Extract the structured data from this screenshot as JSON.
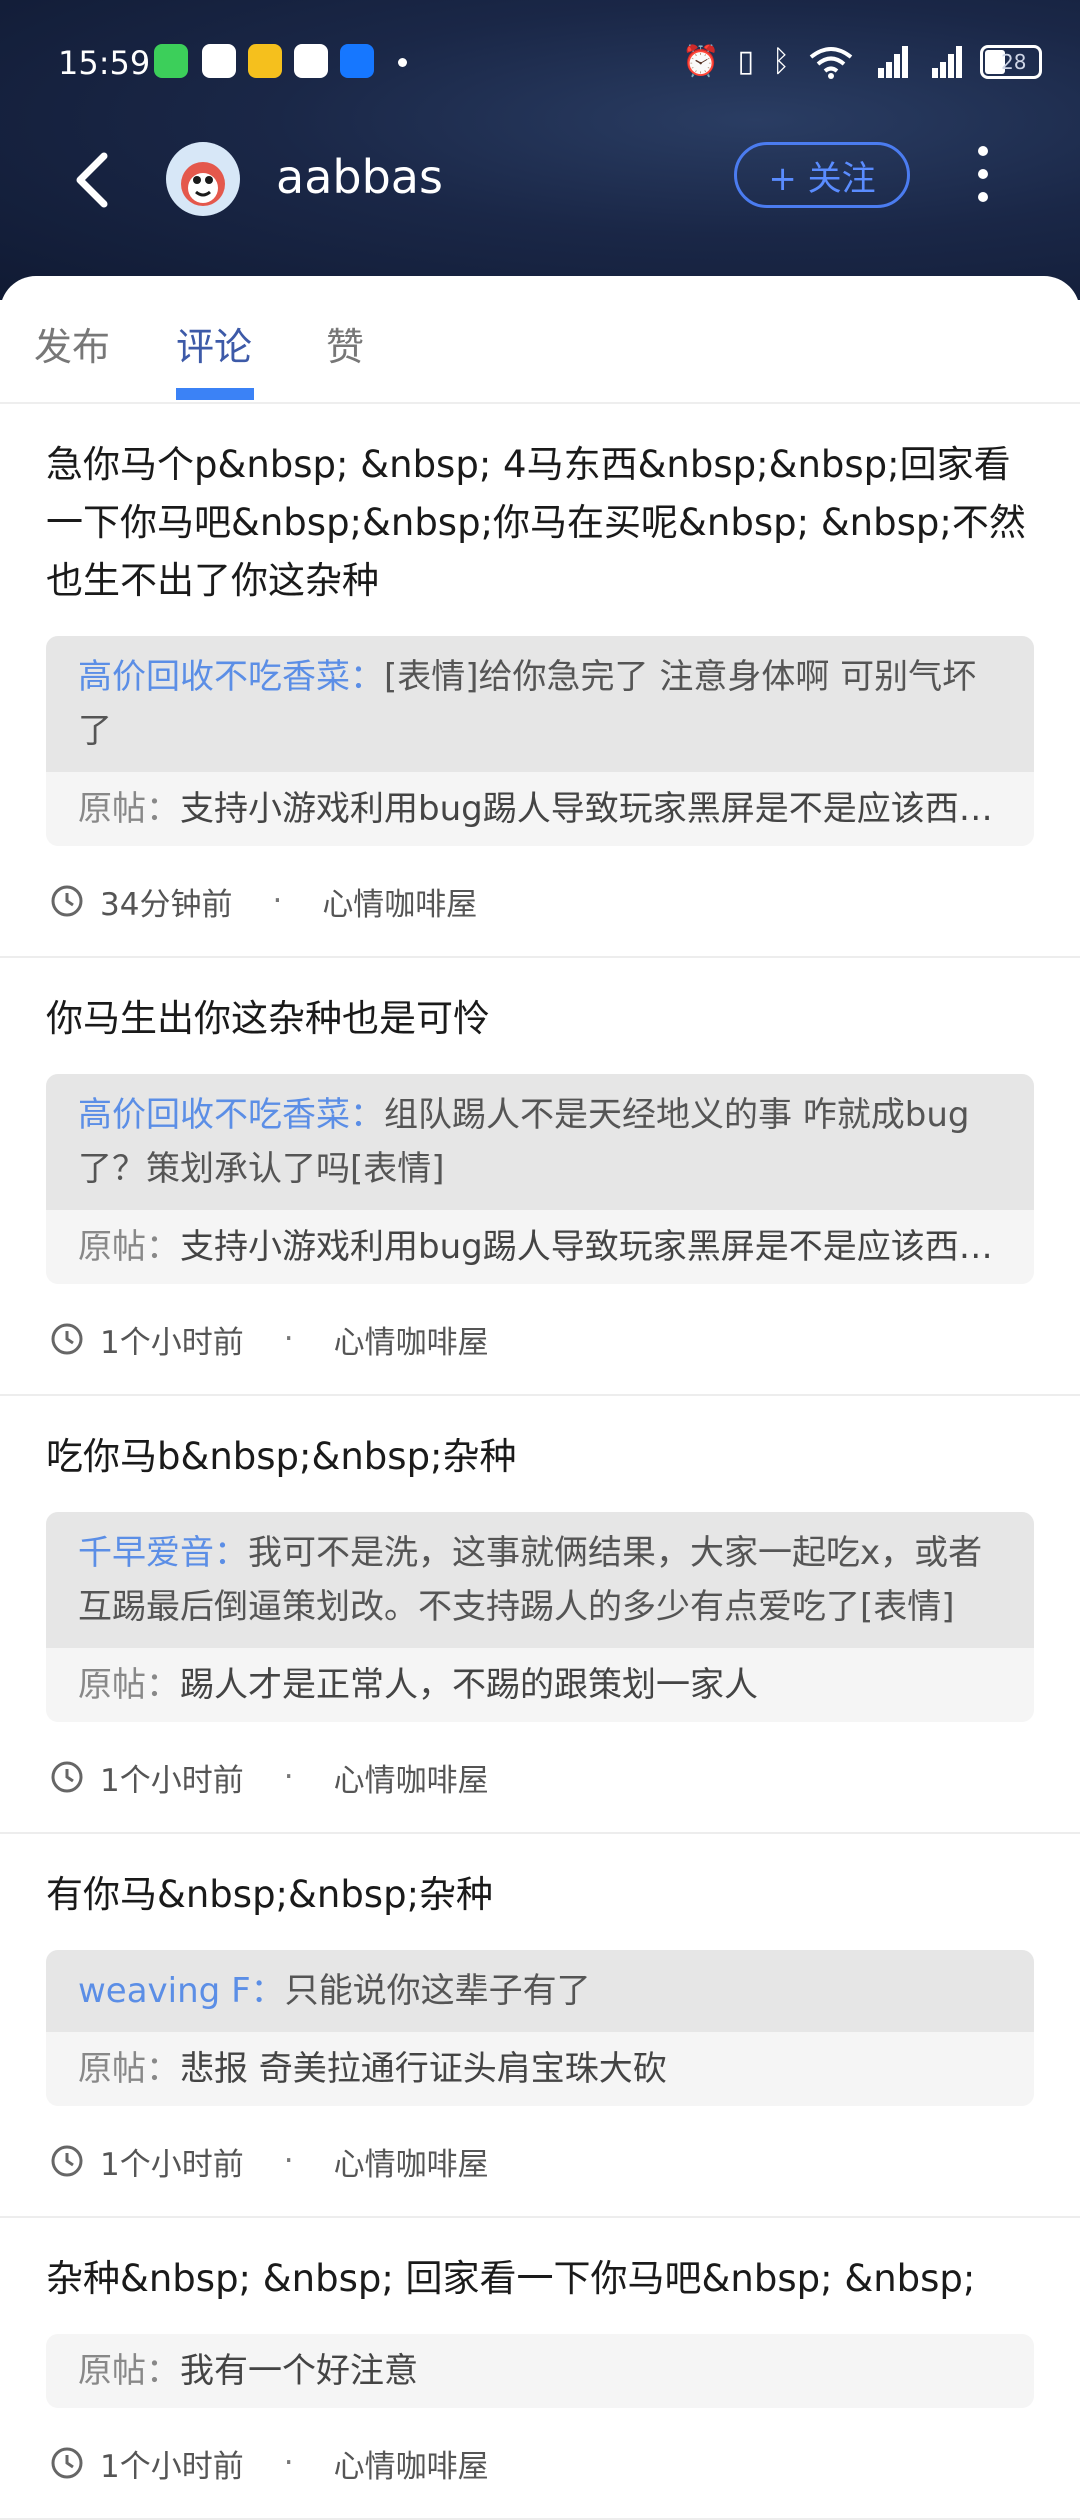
{
  "status_bar": {
    "time": "15:59",
    "battery": "28"
  },
  "header": {
    "username": "aabbas",
    "follow_label": "+ 关注"
  },
  "tabs": [
    {
      "label": "发布",
      "active": false
    },
    {
      "label": "评论",
      "active": true
    },
    {
      "label": "赞",
      "active": false
    }
  ],
  "comments": [
    {
      "text": "急你马个p&nbsp; &nbsp; 4马东西&nbsp;&nbsp;回家看一下你马吧&nbsp;&nbsp;你马在买呢&nbsp; &nbsp;不然也生不出了你这杂种",
      "reply_user": "高价回收不吃香菜：",
      "reply_text": "[表情]给你急完了 注意身体啊 可别气坏了",
      "orig_label": "原帖：",
      "orig_text": "支持小游戏利用bug踢人导致玩家黑屏是不是应该西…",
      "time": "34分钟前",
      "dot": "·",
      "group": "心情咖啡屋"
    },
    {
      "text": "你马生出你这杂种也是可怜",
      "reply_user": "高价回收不吃香菜：",
      "reply_text": "组队踢人不是天经地义的事 咋就成bug了？策划承认了吗[表情]",
      "orig_label": "原帖：",
      "orig_text": "支持小游戏利用bug踢人导致玩家黑屏是不是应该西…",
      "time": "1个小时前",
      "dot": "·",
      "group": "心情咖啡屋"
    },
    {
      "text": "吃你马b&nbsp;&nbsp;杂种",
      "reply_user": "千早爱音：",
      "reply_text": "我可不是洗，这事就俩结果，大家一起吃x，或者互踢最后倒逼策划改。不支持踢人的多少有点爱吃了[表情]",
      "orig_label": "原帖：",
      "orig_text": "踢人才是正常人，不踢的跟策划一家人",
      "time": "1个小时前",
      "dot": "·",
      "group": "心情咖啡屋"
    },
    {
      "text": "有你马&nbsp;&nbsp;杂种",
      "reply_user": "weaving F：",
      "reply_text": "只能说你这辈子有了",
      "orig_label": "原帖：",
      "orig_text": "悲报 奇美拉通行证头肩宝珠大砍",
      "time": "1个小时前",
      "dot": "·",
      "group": "心情咖啡屋"
    },
    {
      "text": "杂种&nbsp; &nbsp; 回家看一下你马吧&nbsp; &nbsp;",
      "orig_label": "原帖：",
      "orig_text": "我有一个好注意",
      "time": "1个小时前",
      "dot": "·",
      "group": "心情咖啡屋"
    }
  ]
}
